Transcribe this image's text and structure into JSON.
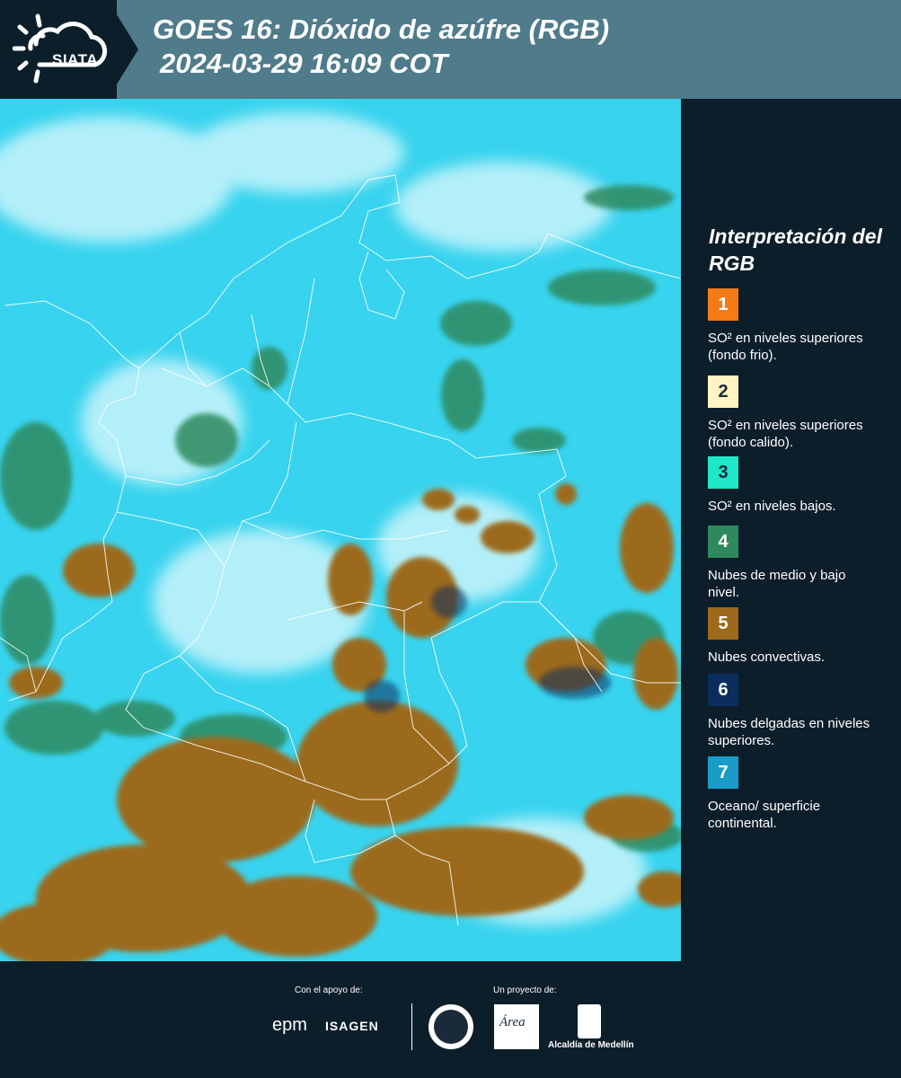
{
  "header": {
    "brand": "SIATA",
    "title": "GOES 16: Dióxido de azúfre (RGB)",
    "subtitle": "2024-03-29 16:09 COT"
  },
  "legend": {
    "title": "Interpretación del RGB",
    "items": [
      {
        "number": "1",
        "label": "SO² en niveles superiores (fondo frio).",
        "color": "#f47b16",
        "text_color": "#ffffff"
      },
      {
        "number": "2",
        "label": "SO² en niveles superiores (fondo calido).",
        "color": "#fff4c2",
        "text_color": "#1a2a3a"
      },
      {
        "number": "3",
        "label": "SO² en niveles bajos.",
        "color": "#1ee8c8",
        "text_color": "#1a2a3a"
      },
      {
        "number": "4",
        "label": "Nubes de medio y bajo nivel.",
        "color": "#2e8a5e",
        "text_color": "#ffffff"
      },
      {
        "number": "5",
        "label": "Nubes convectivas.",
        "color": "#9c6a1a",
        "text_color": "#ffffff"
      },
      {
        "number": "6",
        "label": "Nubes delgadas en niveles superiores.",
        "color": "#0b2d5e",
        "text_color": "#ffffff"
      },
      {
        "number": "7",
        "label": "Oceano/ superficie continental.",
        "color": "#1a9cc8",
        "text_color": "#ffffff"
      }
    ]
  },
  "footer": {
    "support_label": "Con el apoyo de:",
    "project_label": "Un proyecto de:",
    "sponsor_1": "epm",
    "sponsor_2": "ISAGEN",
    "area_logo_text": "Área",
    "alcaldia": "Alcaldía de Medellín"
  },
  "colors": {
    "header_band": "#4f7b8b",
    "panel_bg": "#0d1e2b",
    "map_base": "#38d3ee",
    "convective": "#9c6a1a",
    "mid_low_cloud": "#2e8a5e"
  }
}
